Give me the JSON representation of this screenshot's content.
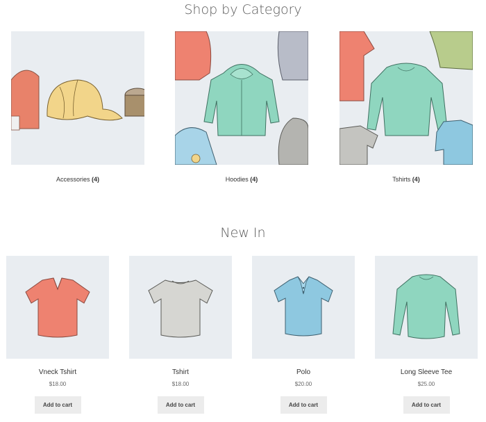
{
  "headings": {
    "shop_by_category": "Shop by Category",
    "new_in": "New In"
  },
  "categories": [
    {
      "label": "Accessories",
      "count": "(4)"
    },
    {
      "label": "Hoodies",
      "count": "(4)"
    },
    {
      "label": "Tshirts",
      "count": "(4)"
    }
  ],
  "products": [
    {
      "name": "Vneck Tshirt",
      "price": "$18.00",
      "button": "Add to cart"
    },
    {
      "name": "Tshirt",
      "price": "$18.00",
      "button": "Add to cart"
    },
    {
      "name": "Polo",
      "price": "$20.00",
      "button": "Add to cart"
    },
    {
      "name": "Long Sleeve Tee",
      "price": "$25.00",
      "button": "Add to cart"
    }
  ],
  "colors": {
    "image_background": "#e9edf1",
    "button_background": "#ececec",
    "heading": "#5a5a5a"
  }
}
